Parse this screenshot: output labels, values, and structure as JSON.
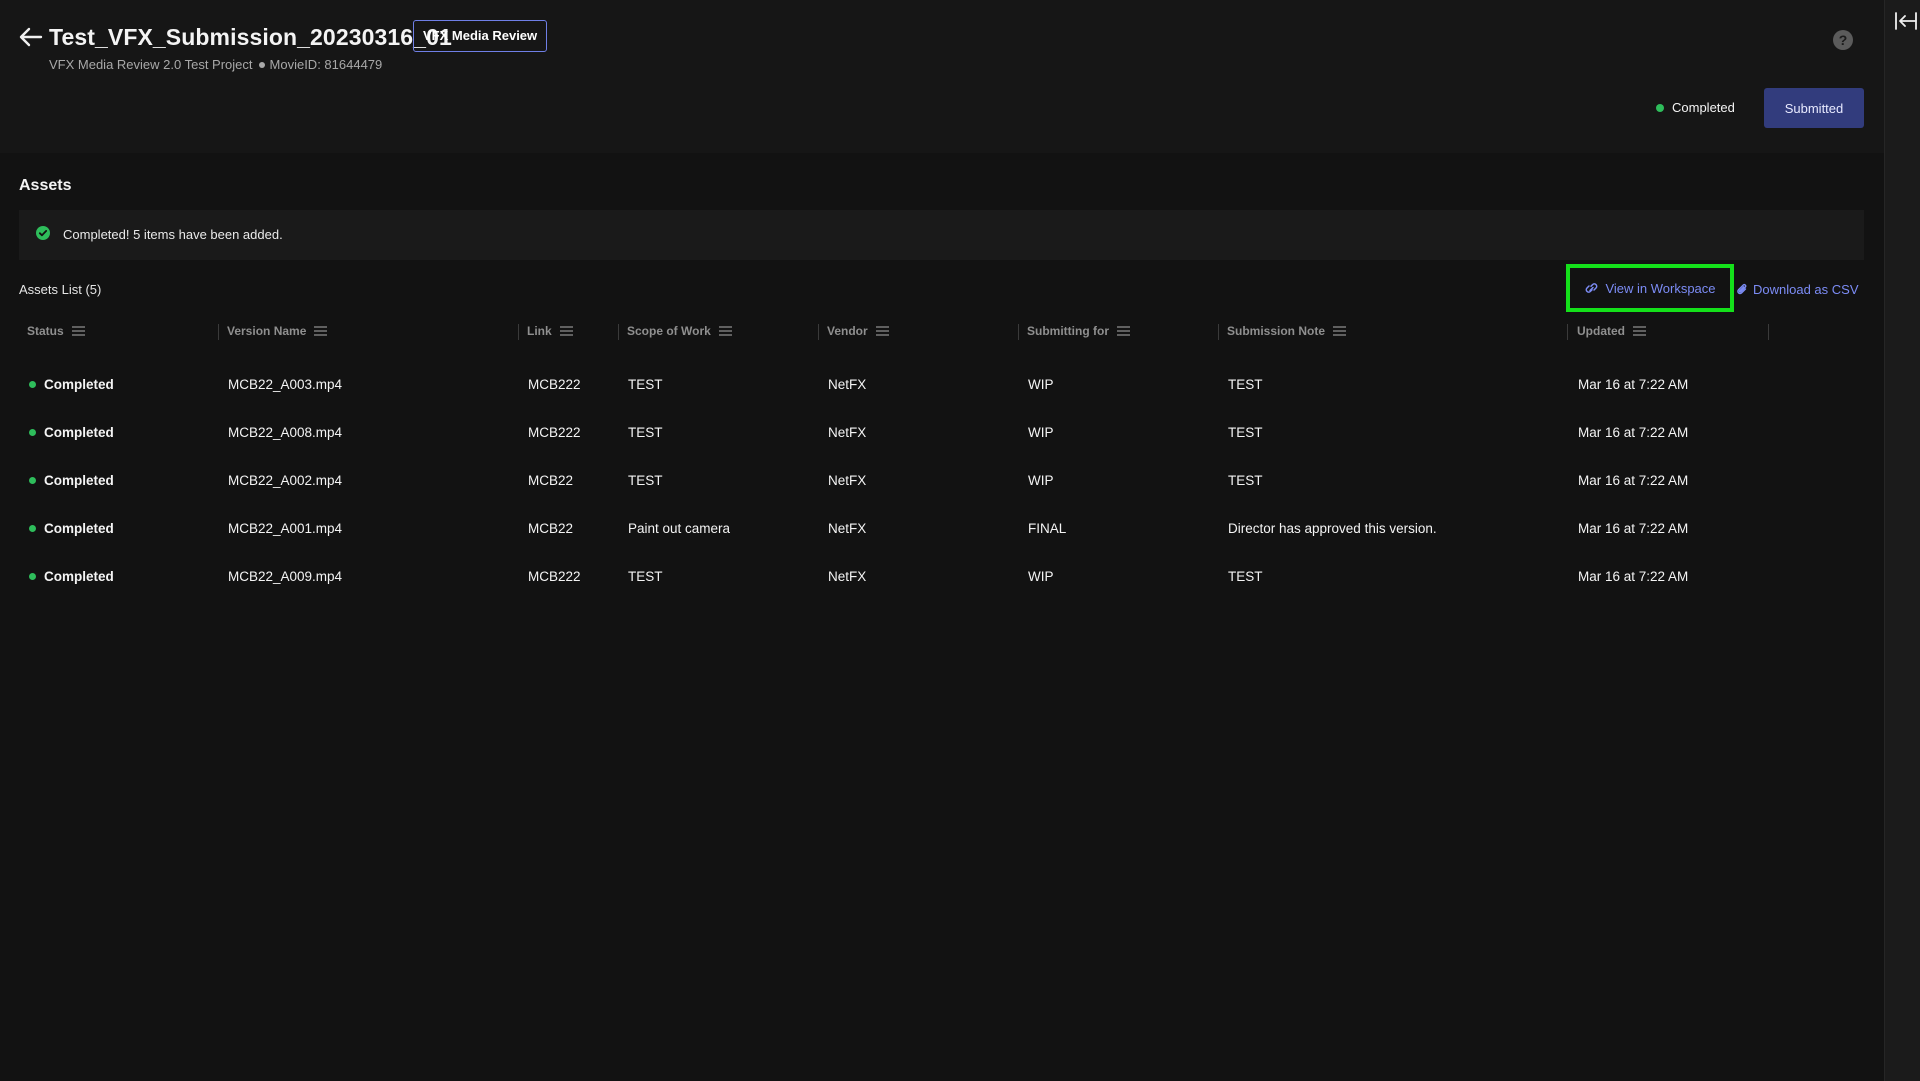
{
  "header": {
    "title": "Test_VFX_Submission_20230316_01",
    "tag": "VFX Media Review",
    "project": "VFX Media Review 2.0 Test Project",
    "movie_id": "MovieID: 81644479",
    "help_glyph": "?",
    "status": "Completed",
    "submitted_label": "Submitted"
  },
  "assets": {
    "section_title": "Assets",
    "banner_message": "Completed! 5 items have been added.",
    "list_title": "Assets List (5)",
    "view_workspace_label": "View in Workspace",
    "download_csv_label": "Download as CSV",
    "columns": [
      "Status",
      "Version Name",
      "Link",
      "Scope of Work",
      "Vendor",
      "Submitting for",
      "Submission Note",
      "Updated"
    ],
    "rows": [
      {
        "status": "Completed",
        "version": "MCB22_A003.mp4",
        "link": "MCB222",
        "scope": "TEST",
        "vendor": "NetFX",
        "submitting_for": "WIP",
        "note": "TEST",
        "updated": "Mar 16 at 7:22 AM"
      },
      {
        "status": "Completed",
        "version": "MCB22_A008.mp4",
        "link": "MCB222",
        "scope": "TEST",
        "vendor": "NetFX",
        "submitting_for": "WIP",
        "note": "TEST",
        "updated": "Mar 16 at 7:22 AM"
      },
      {
        "status": "Completed",
        "version": "MCB22_A002.mp4",
        "link": "MCB22",
        "scope": "TEST",
        "vendor": "NetFX",
        "submitting_for": "WIP",
        "note": "TEST",
        "updated": "Mar 16 at 7:22 AM"
      },
      {
        "status": "Completed",
        "version": "MCB22_A001.mp4",
        "link": "MCB22",
        "scope": "Paint out camera",
        "vendor": "NetFX",
        "submitting_for": "FINAL",
        "note": "Director has approved this version.",
        "updated": "Mar 16 at 7:22 AM"
      },
      {
        "status": "Completed",
        "version": "MCB22_A009.mp4",
        "link": "MCB222",
        "scope": "TEST",
        "vendor": "NetFX",
        "submitting_for": "WIP",
        "note": "TEST",
        "updated": "Mar 16 at 7:22 AM"
      }
    ]
  },
  "colors": {
    "background": "#121212",
    "header_bg": "#161616",
    "accent_link": "#7c8cf5",
    "submitted_button": "#323c7d",
    "status_green": "#2ebd5b",
    "highlight_box": "#14e01a"
  },
  "icons": {
    "back": "arrow-left-icon",
    "help": "help-icon",
    "collapse": "collapse-panel-icon",
    "banner": "check-circle-icon",
    "view_workspace": "link-icon",
    "download_csv": "paperclip-icon",
    "column_menu": "menu-icon"
  }
}
